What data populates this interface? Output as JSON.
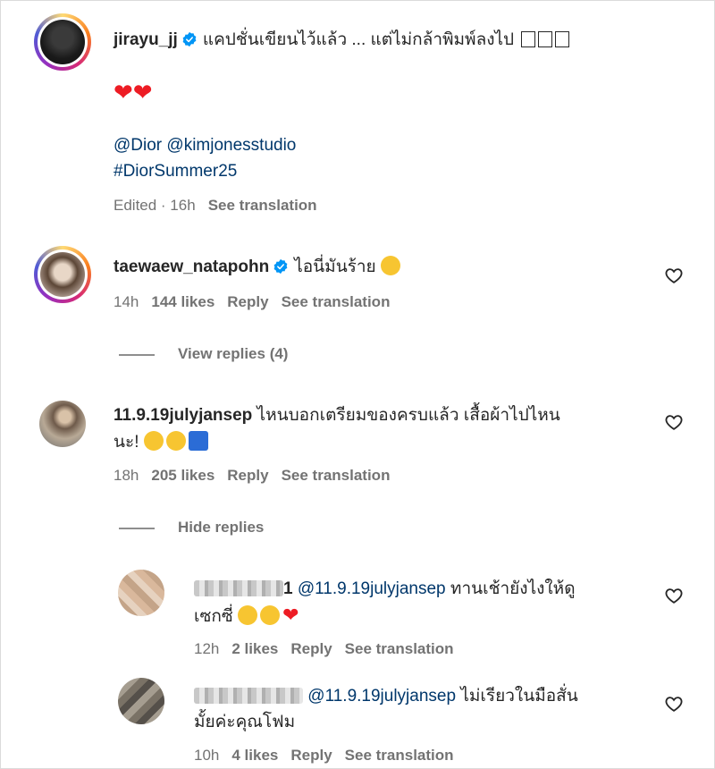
{
  "post": {
    "username": "jirayu_jj",
    "caption": "แคปชั่นเขียนไว้แล้ว ... แต่ไม่กล้าพิมพ์ลงไป",
    "caption_boxes": "□□□",
    "hearts": "❤❤",
    "mentions": "@Dior @kimjonesstudio",
    "hashtag": "#DiorSummer25",
    "edited": "Edited · 16h",
    "see_translation": "See translation"
  },
  "comments": [
    {
      "username": "taewaew_natapohn",
      "text": "ไอนี่มันร้าย",
      "time": "14h",
      "likes": "144 likes",
      "reply": "Reply",
      "see_translation": "See translation",
      "toggle": "View replies (4)"
    },
    {
      "username": "11.9.19julyjansep",
      "text_line1": "ไหนบอกเตรียมของครบแล้ว เสื้อผ้าไปไหน",
      "text_line2": "นะ!",
      "time": "18h",
      "likes": "205 likes",
      "reply": "Reply",
      "see_translation": "See translation",
      "toggle": "Hide replies"
    }
  ],
  "replies": [
    {
      "username_suffix": "1",
      "mention": "@11.9.19julyjansep",
      "text_line1": "ทานเช้ายังไงให้ดู",
      "text_line2": "เซกซี่",
      "time": "12h",
      "likes": "2 likes",
      "reply": "Reply",
      "see_translation": "See translation"
    },
    {
      "mention": "@11.9.19julyjansep",
      "text_line1": "ไม่เรียวในมือสั่น",
      "text_line2": "มั้ยค่ะคุณโฟม",
      "time": "10h",
      "likes": "4 likes",
      "reply": "Reply",
      "see_translation": "See translation"
    }
  ],
  "colors": {
    "verified": "#0095f6",
    "heart_red": "#ed1c24",
    "mention": "#00376b",
    "meta": "#737373"
  }
}
